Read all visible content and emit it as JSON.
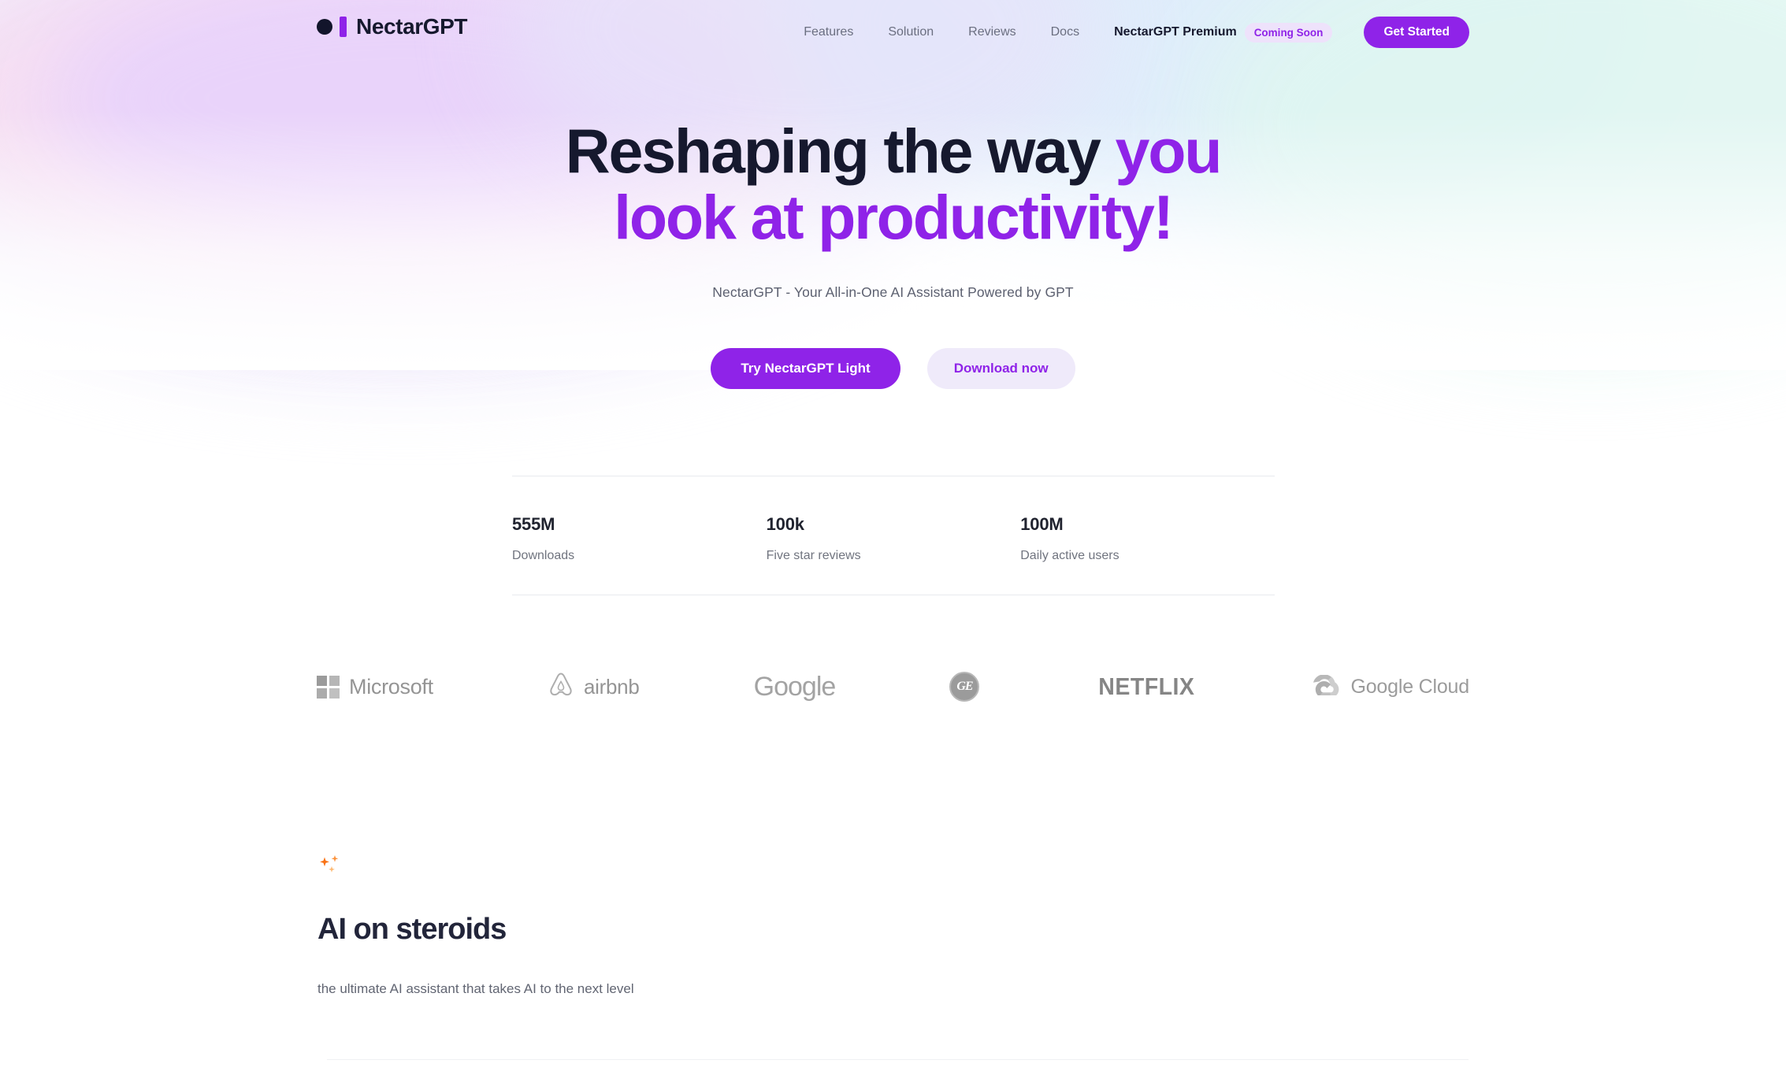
{
  "brand": {
    "name": "NectarGPT",
    "dot_icon": "circle-dot-icon",
    "bar_icon": "bar-icon"
  },
  "nav": {
    "links": [
      {
        "label": "Features"
      },
      {
        "label": "Solution"
      },
      {
        "label": "Reviews"
      },
      {
        "label": "Docs"
      }
    ],
    "premium_label": "NectarGPT Premium",
    "premium_badge": "Coming Soon",
    "cta_label": "Get Started"
  },
  "hero": {
    "headline_line1_dark": "Reshaping the way ",
    "headline_line1_accent": "you",
    "headline_line2": "look at productivity!",
    "subtitle": "NectarGPT - Your All-in-One AI Assistant Powered by GPT",
    "primary_cta": "Try NectarGPT Light",
    "secondary_cta": "Download now"
  },
  "stats": [
    {
      "value": "555M",
      "label": "Downloads"
    },
    {
      "value": "100k",
      "label": "Five star reviews"
    },
    {
      "value": "100M",
      "label": "Daily active users"
    }
  ],
  "logos": [
    {
      "name": "Microsoft",
      "icon": "microsoft-grid-icon"
    },
    {
      "name": "airbnb",
      "icon": "airbnb-belo-icon"
    },
    {
      "name": "Google",
      "icon": "google-wordmark-icon"
    },
    {
      "name": "GE",
      "icon": "ge-monogram-icon"
    },
    {
      "name": "NETFLIX",
      "icon": "netflix-wordmark-icon"
    },
    {
      "name": "Google Cloud",
      "icon": "google-cloud-icon"
    }
  ],
  "feature": {
    "sparkle_icon": "sparkle-icon",
    "heading": "AI on steroids",
    "subtitle": "the ultimate AI assistant that takes AI to the next level"
  },
  "colors": {
    "accent_purple": "#8f23e8",
    "accent_purple_soft": "#efeafa",
    "text_dark": "#16192e",
    "text_muted": "#6b6f80",
    "sparkle_orange": "#f97316",
    "divider": "#e9eaee"
  }
}
